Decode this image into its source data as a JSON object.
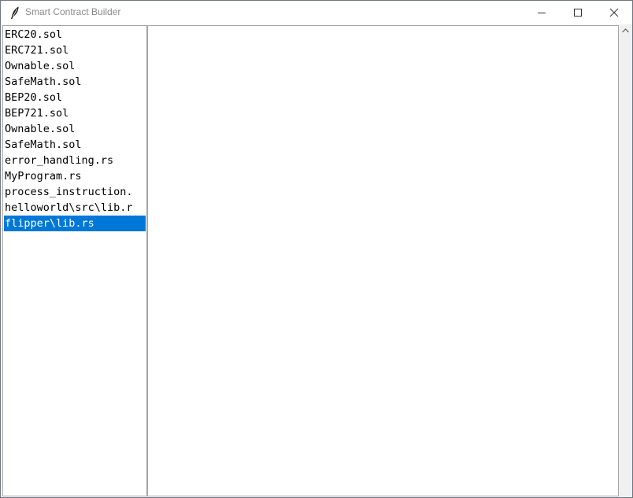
{
  "window": {
    "title": "Smart Contract Builder",
    "app_icon": "feather-icon",
    "controls": [
      "minimize-icon",
      "maximize-icon",
      "close-icon"
    ]
  },
  "file_list": {
    "items": [
      "ERC20.sol",
      "ERC721.sol",
      "Ownable.sol",
      "SafeMath.sol",
      "BEP20.sol",
      "BEP721.sol",
      "Ownable.sol",
      "SafeMath.sol",
      "error_handling.rs",
      "MyProgram.rs",
      "process_instruction.",
      "helloworld\\src\\lib.r",
      "flipper\\lib.rs"
    ],
    "selected_index": 12
  },
  "editor": {
    "content": ""
  },
  "colors": {
    "selection": "#0078d7",
    "selection_text": "#ffffff",
    "border": "#a5a5a5",
    "scrollbar": "#f0f0f0"
  }
}
